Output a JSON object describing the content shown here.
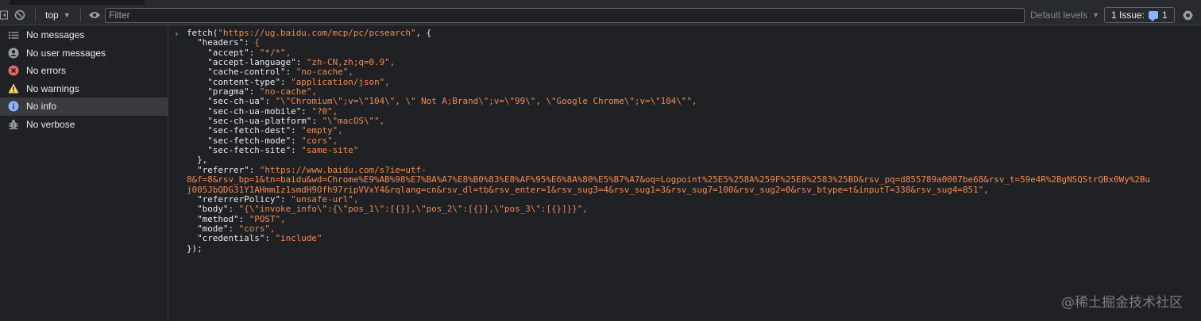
{
  "toolbar": {
    "context": "top",
    "filter_placeholder": "Filter",
    "levels_label": "Default levels",
    "issues_label": "1 Issue:",
    "issues_count": "1"
  },
  "sidebar": {
    "items": [
      {
        "label": "No messages",
        "icon": "list-icon"
      },
      {
        "label": "No user messages",
        "icon": "user-icon"
      },
      {
        "label": "No errors",
        "icon": "error-icon"
      },
      {
        "label": "No warnings",
        "icon": "warning-icon"
      },
      {
        "label": "No info",
        "icon": "info-icon"
      },
      {
        "label": "No verbose",
        "icon": "bug-icon"
      }
    ]
  },
  "console": {
    "prompt": "›",
    "code": "fetch(\"https://ug.baidu.com/mcp/pc/pcsearch\", {\n  \"headers\": {\n    \"accept\": \"*/*\",\n    \"accept-language\": \"zh-CN,zh;q=0.9\",\n    \"cache-control\": \"no-cache\",\n    \"content-type\": \"application/json\",\n    \"pragma\": \"no-cache\",\n    \"sec-ch-ua\": \"\\\"Chromium\\\";v=\\\"104\\\", \\\" Not A;Brand\\\";v=\\\"99\\\", \\\"Google Chrome\\\";v=\\\"104\\\"\",\n    \"sec-ch-ua-mobile\": \"?0\",\n    \"sec-ch-ua-platform\": \"\\\"macOS\\\"\",\n    \"sec-fetch-dest\": \"empty\",\n    \"sec-fetch-mode\": \"cors\",\n    \"sec-fetch-site\": \"same-site\"\n  },\n  \"referrer\": \"https://www.baidu.com/s?ie=utf-\n8&f=8&rsv_bp=1&tn=baidu&wd=Chrome%E9%AB%98%E7%BA%A7%E8%B0%83%E8%AF%95%E6%8A%80%E5%B7%A7&oq=Logpoint%25E5%258A%259F%25E8%2583%25BD&rsv_pq=d855789a0007be68&rsv_t=59e4R%2BgNSQStrQBx0Wy%2Bu\nj005JbQDG31Y1AHmmIz1smdH9Ofh97ripVVxY4&rqlang=cn&rsv_dl=tb&rsv_enter=1&rsv_sug3=4&rsv_sug1=3&rsv_sug7=100&rsv_sug2=0&rsv_btype=t&inputT=338&rsv_sug4=851\",\n  \"referrerPolicy\": \"unsafe-url\",\n  \"body\": \"{\\\"invoke_info\\\":{\\\"pos_1\\\":[{}],\\\"pos_2\\\":[{}],\\\"pos_3\\\":[{}]}}\",\n  \"method\": \"POST\",\n  \"mode\": \"cors\",\n  \"credentials\": \"include\"\n});"
  },
  "watermark": "@稀土掘金技术社区",
  "colors": {
    "background": "#202124",
    "toolbar": "#292a2d",
    "code_string": "#f28b54",
    "selected": "#393b3f",
    "error": "#e46962",
    "warning": "#fdd663",
    "info": "#8ab4f8"
  }
}
